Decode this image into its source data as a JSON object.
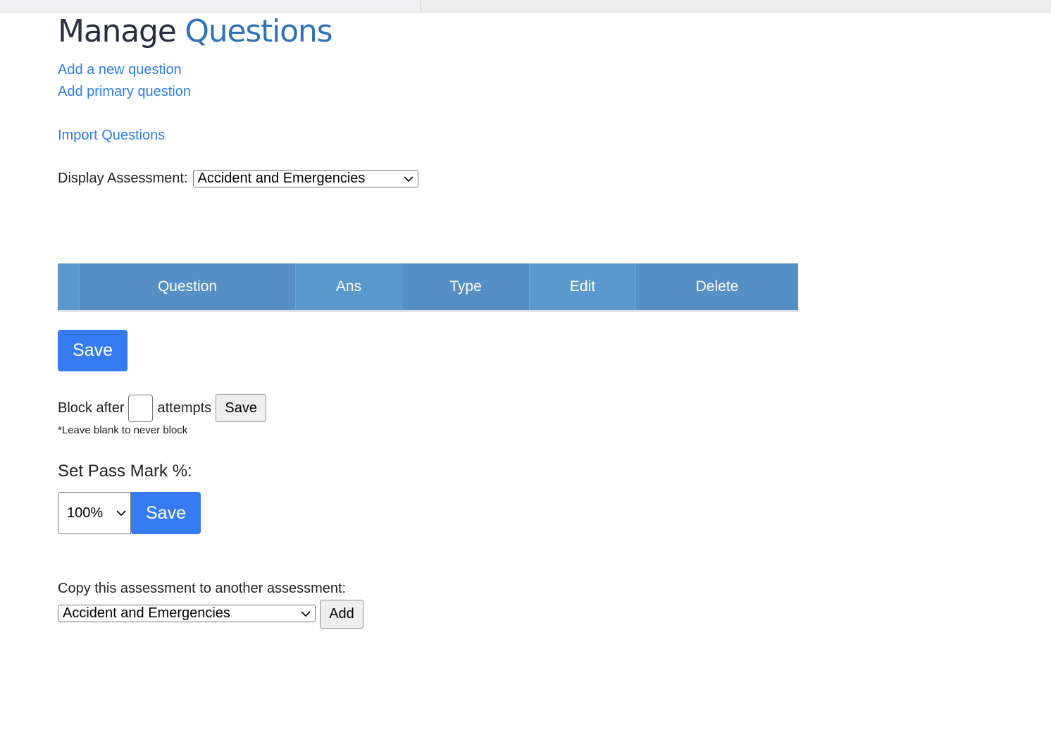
{
  "header": {
    "title_part1": "Manage",
    "title_part2": "Questions"
  },
  "links": {
    "add_new": "Add a new question",
    "add_primary": "Add primary question",
    "import": "Import Questions"
  },
  "display_assessment": {
    "label": "Display Assessment:",
    "selected": "Accident and Emergencies"
  },
  "table": {
    "columns": [
      "",
      "Question",
      "Ans",
      "Type",
      "Edit",
      "Delete"
    ],
    "rows": []
  },
  "save_button": "Save",
  "block": {
    "label_before": "Block after",
    "value": "",
    "label_after": "attempts",
    "save_label": "Save",
    "note": "*Leave blank to never block"
  },
  "pass_mark": {
    "label": "Set Pass Mark %:",
    "selected": "100%",
    "save_label": "Save"
  },
  "copy": {
    "label": "Copy this assessment to another assessment:",
    "selected": "Accident and Emergencies",
    "add_label": "Add"
  },
  "colors": {
    "link": "#2f7cf0",
    "primary_button": "#377bf3",
    "table_header": "#558fc5",
    "title_accent": "#2f72b8"
  }
}
